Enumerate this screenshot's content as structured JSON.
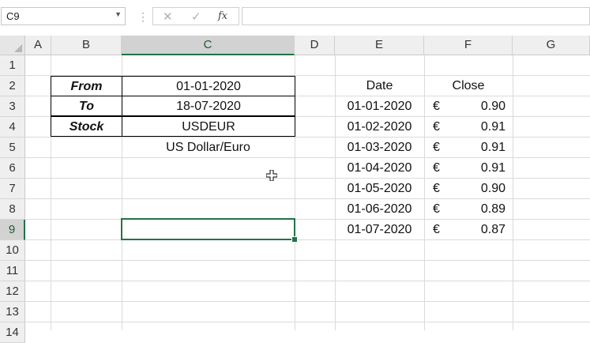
{
  "formula_bar": {
    "name_box": "C9",
    "cancel_icon": "✕",
    "enter_icon": "✓",
    "fx_label": "fx",
    "formula": ""
  },
  "columns": [
    "A",
    "B",
    "C",
    "D",
    "E",
    "F",
    "G"
  ],
  "selected_column": "C",
  "rows": [
    "1",
    "2",
    "3",
    "4",
    "5",
    "6",
    "7",
    "8",
    "9",
    "10",
    "11",
    "12",
    "13",
    "14"
  ],
  "selected_row": "9",
  "input_table": {
    "from_label": "From",
    "from_value": "01-01-2020",
    "to_label": "To",
    "to_value": "18-07-2020",
    "stock_label": "Stock",
    "stock_value": "USDEUR",
    "stock_name": "US Dollar/Euro"
  },
  "price_table": {
    "headers": [
      "Date",
      "Close"
    ],
    "currency": "€",
    "rows": [
      {
        "date": "01-01-2020",
        "close": "0.90"
      },
      {
        "date": "01-02-2020",
        "close": "0.91"
      },
      {
        "date": "01-03-2020",
        "close": "0.91"
      },
      {
        "date": "01-04-2020",
        "close": "0.91"
      },
      {
        "date": "01-05-2020",
        "close": "0.90"
      },
      {
        "date": "01-06-2020",
        "close": "0.89"
      },
      {
        "date": "01-07-2020",
        "close": "0.87"
      }
    ]
  },
  "colors": {
    "accent": "#217346"
  }
}
